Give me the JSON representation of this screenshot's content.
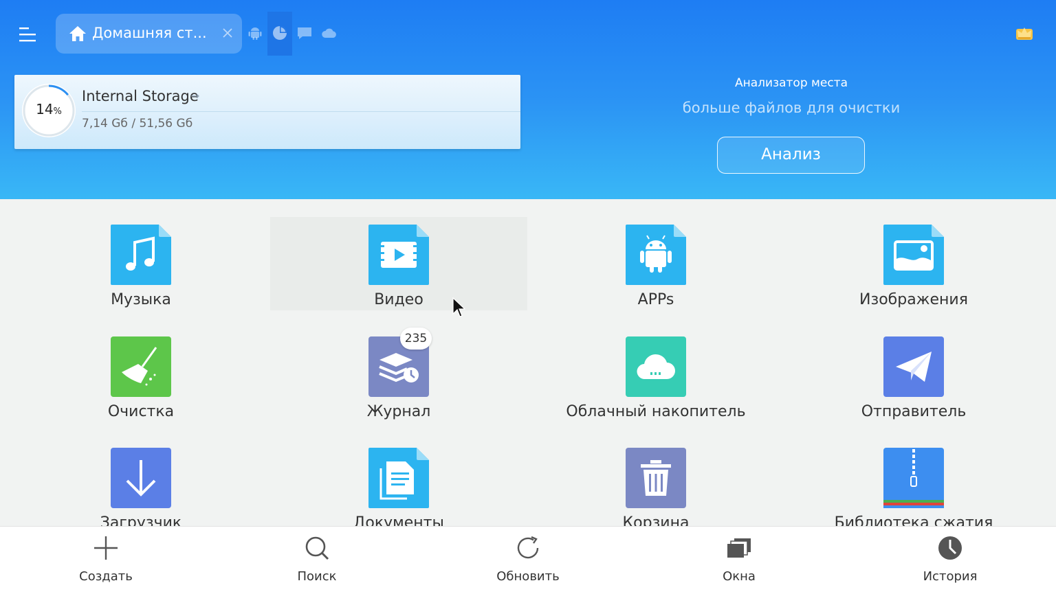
{
  "header": {
    "tab": {
      "title": "Домашняя ст...",
      "close_glyph": "✕"
    },
    "toolbar_icons": [
      "android-icon",
      "pie-chart-icon",
      "screen-icon",
      "cloud-icon"
    ],
    "premium_icon": "crown-icon"
  },
  "storage": {
    "percent": "14",
    "percent_sign": "%",
    "percent_value": 14,
    "title": "Internal Storage",
    "arrow": "→",
    "size": "7,14 Gб / 51,56 Gб"
  },
  "analyzer": {
    "title": "Анализатор места",
    "subtitle": "больше файлов для очистки",
    "button": "Анализ"
  },
  "categories": [
    {
      "label": "Музыка",
      "icon": "music-icon",
      "color": "#2cb4f0"
    },
    {
      "label": "Видео",
      "icon": "video-icon",
      "color": "#2cb4f0"
    },
    {
      "label": "APPs",
      "icon": "android-icon",
      "color": "#2cb4f0"
    },
    {
      "label": "Изображения",
      "icon": "image-icon",
      "color": "#2cb4f0"
    },
    {
      "label": "Очистка",
      "icon": "broom-icon",
      "color": "#5dc64a"
    },
    {
      "label": "Журнал",
      "icon": "log-icon",
      "color": "#7b88c4",
      "badge": "235"
    },
    {
      "label": "Облачный накопитель",
      "icon": "cloud-storage-icon",
      "color": "#36cdb4"
    },
    {
      "label": "Отправитель",
      "icon": "sender-icon",
      "color": "#5b7fe6"
    },
    {
      "label": "Загрузчик",
      "icon": "download-icon",
      "color": "#5b7fe6"
    },
    {
      "label": "Документы",
      "icon": "document-icon",
      "color": "#2cb4f0"
    },
    {
      "label": "Корзина",
      "icon": "trash-icon",
      "color": "#7b88c4"
    },
    {
      "label": "Библиотека сжатия",
      "icon": "archive-icon",
      "color": "#3d8ef0"
    }
  ],
  "bottom_bar": [
    {
      "label": "Создать",
      "icon": "plus-icon"
    },
    {
      "label": "Поиск",
      "icon": "search-icon"
    },
    {
      "label": "Обновить",
      "icon": "refresh-icon"
    },
    {
      "label": "Окна",
      "icon": "windows-icon"
    },
    {
      "label": "История",
      "icon": "history-icon"
    }
  ]
}
